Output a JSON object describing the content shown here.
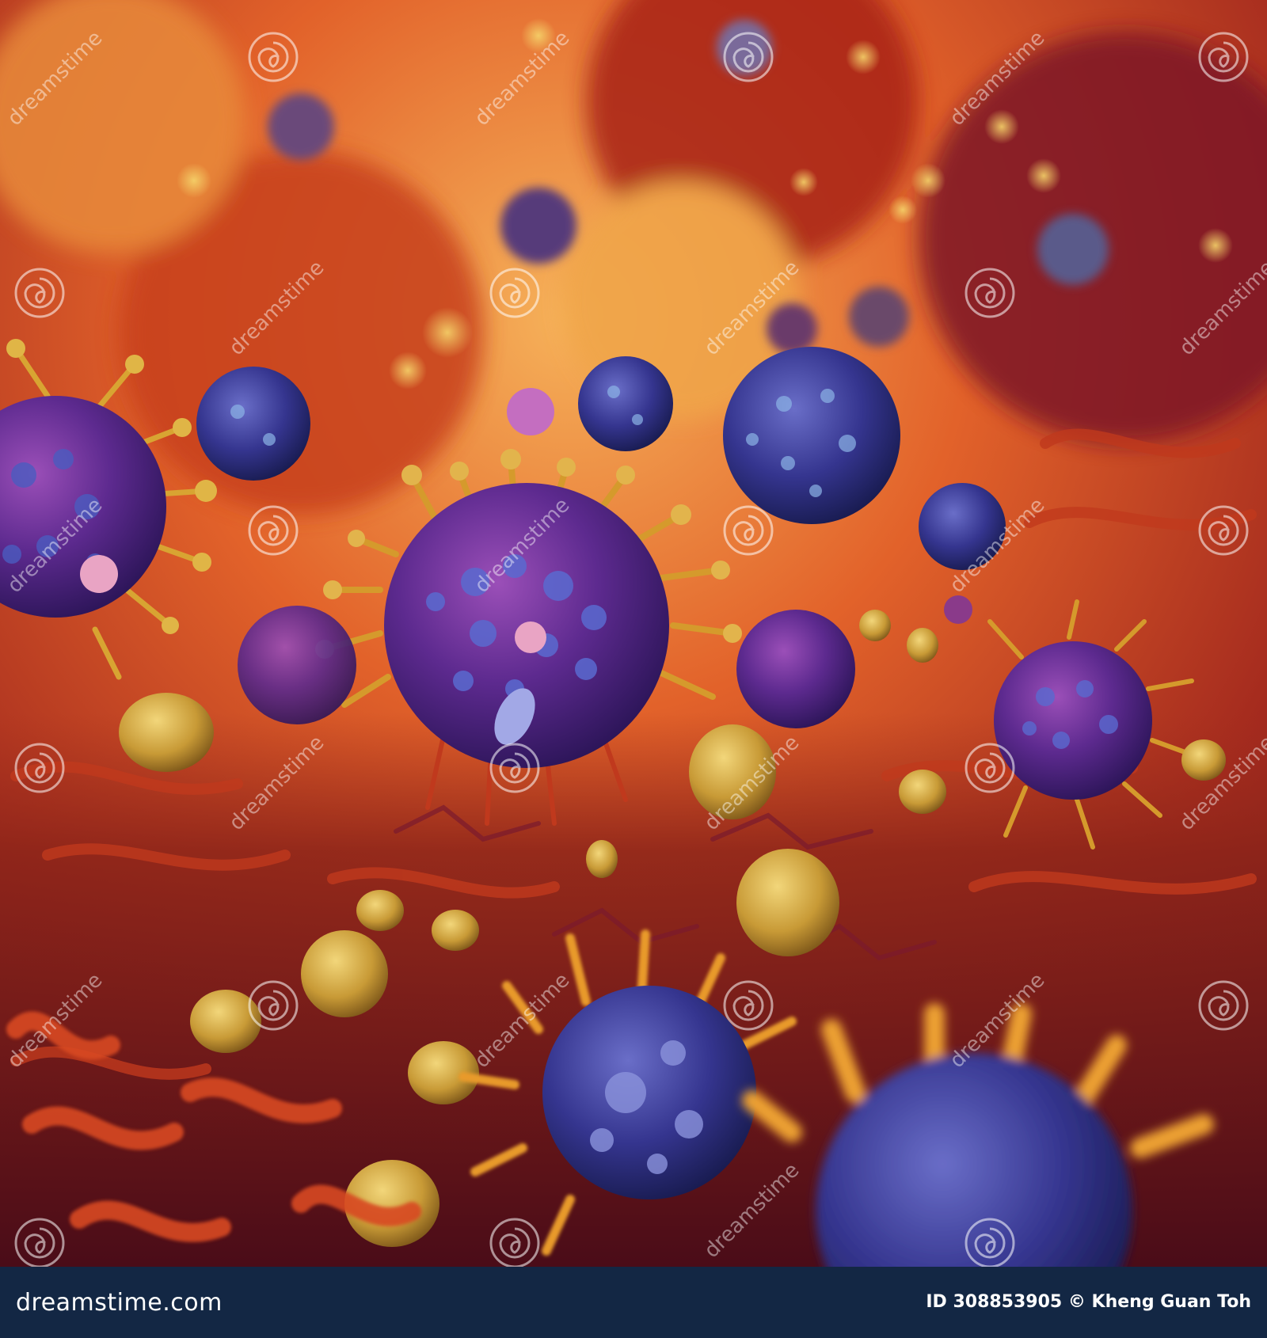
{
  "image": {
    "subject": "microscopic cells with spiky projections",
    "watermark_text": "dreamstime",
    "watermark_logo": "spiral-icon"
  },
  "footer": {
    "brand": "dreamstime.com",
    "credit": "ID 308853905 © Kheng Guan Toh"
  },
  "colors": {
    "footer_bg": "#132744",
    "footer_text": "#ffffff",
    "background_warm": "#d2461e",
    "background_dark": "#6e1420",
    "cell_purple": "#5a2a8c",
    "cell_blue": "#3c3c96",
    "spike_gold": "#d2a02d"
  }
}
